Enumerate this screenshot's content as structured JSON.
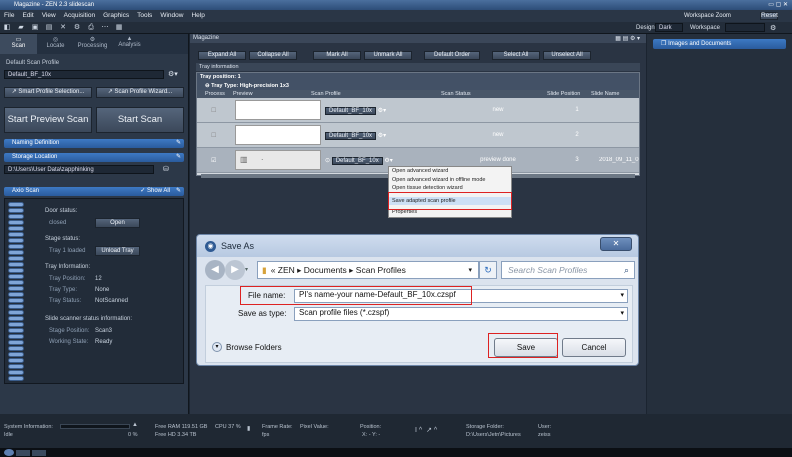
{
  "window": {
    "title": "Magazine - ZEN 2.3 slidescan"
  },
  "menu": [
    "File",
    "Edit",
    "View",
    "Acquisition",
    "Graphics",
    "Tools",
    "Window",
    "Help"
  ],
  "toolbar": {
    "workspace_zoom": "Workspace Zoom",
    "reset_label": "Reset",
    "design_label": "Design",
    "design_value": "Dark",
    "workspace_label": "Workspace"
  },
  "left_tabs": [
    "Scan",
    "Locate",
    "Processing",
    "Analysis"
  ],
  "scan_profile": {
    "label": "Default Scan Profile",
    "value": "Default_BF_10x",
    "smart_button": "Smart Profile Selection...",
    "wizard_button": "Scan Profile Wizard...",
    "start_preview": "Start Preview Scan",
    "start_scan": "Start Scan"
  },
  "naming": {
    "label": "Naming Definition"
  },
  "storage": {
    "label": "Storage Location",
    "path": "D:\\Users\\User Data\\zapphinking"
  },
  "axio": {
    "label": "Axio Scan",
    "show_all": "Show All",
    "door_status_label": "Door status:",
    "door_value": "closed",
    "open_button": "Open",
    "stage_status_label": "Stage status:",
    "stage_value": "Tray 1 loaded",
    "unload_button": "Unload Tray",
    "tray_info_label": "Tray Information:",
    "tray_position_label": "Tray Position:",
    "tray_position_value": "12",
    "tray_type_label": "Tray Type:",
    "tray_type_value": "None",
    "tray_status_label": "Tray Status:",
    "tray_status_value": "NotScanned",
    "slide_info_label": "Slide scanner status information:",
    "stage_position_label": "Stage Position:",
    "stage_position_value": "Scan3",
    "working_state_label": "Working State:",
    "working_state_value": "Ready"
  },
  "magazine": {
    "header": "Magazine",
    "buttons": [
      "Expand All",
      "Collapse All",
      "Mark All",
      "Unmark All",
      "Default Order",
      "Select All",
      "Unselect All"
    ],
    "tray_information": "Tray information",
    "tray_position": "Tray position:  1",
    "tray_type": "Tray Type:  High-precision 1x3",
    "columns": [
      "Process",
      "Preview",
      "Scan Profile",
      "Scan Status",
      "Slide Position",
      "Slide Name"
    ],
    "rows": [
      {
        "profile": "Default_BF_10x",
        "status": "new",
        "position": "1",
        "name": ""
      },
      {
        "profile": "Default_BF_10x",
        "status": "new",
        "position": "2",
        "name": ""
      },
      {
        "profile": "Default_BF_10x",
        "status": "preview done",
        "position": "3",
        "name": "2018_09_11_0"
      }
    ]
  },
  "context_menu": [
    "Open advanced wizard",
    "Open advanced wizard in offline mode",
    "Open tissue detection wizard",
    "Save adapted scan profile",
    "Properties"
  ],
  "right_panel": {
    "title": "Images and Documents"
  },
  "dialog": {
    "title": "Save As",
    "path": [
      "«",
      "ZEN",
      "Documents",
      "Scan Profiles"
    ],
    "search_placeholder": "Search Scan Profiles",
    "file_name_label": "File name:",
    "file_name_value": "PI's name-your name-Default_BF_10x.czspf",
    "save_type_label": "Save as type:",
    "save_type_value": "Scan profile files (*.czspf)",
    "browse_folders": "Browse Folders",
    "save_button": "Save",
    "cancel_button": "Cancel"
  },
  "status": {
    "sys_info": "System Information:",
    "idle": "Idle",
    "progress": "0 %",
    "free_ram": "Free RAM 119.51 GB",
    "free_hd": "Free HD  3.34 TB",
    "cpu": "CPU 37 %",
    "frame_rate": "Frame Rate:",
    "fps": "fps",
    "pixel_value": "Pixel Value:",
    "position": "Position:",
    "xy": "X: -    Y: -",
    "storage_folder": "Storage Folder:",
    "storage_path": "D:\\Users\\Jetn\\Pictures",
    "user": "User:",
    "user_value": "zeiss"
  },
  "colors": {
    "accent": "#2f6bb8",
    "highlight_red": "#d22222"
  }
}
